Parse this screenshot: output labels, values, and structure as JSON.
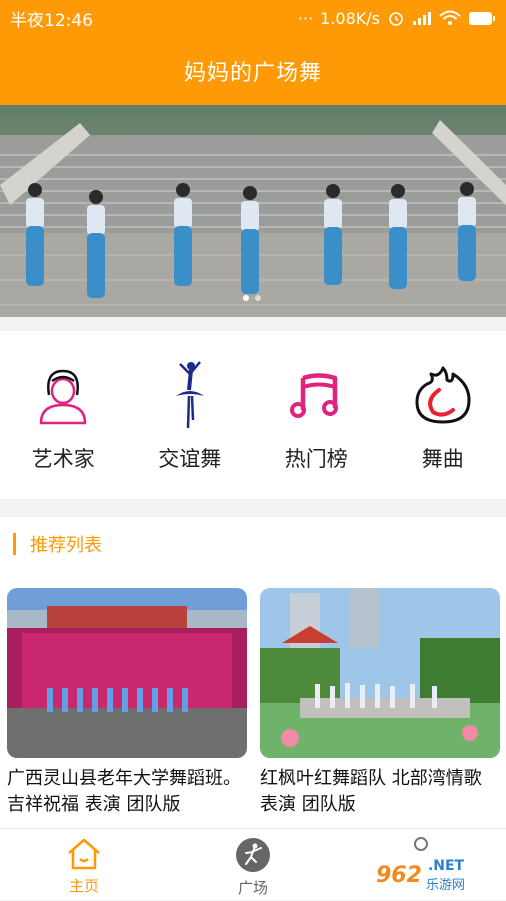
{
  "status_bar": {
    "time": "半夜12:46",
    "speed": "1.08K/s"
  },
  "header": {
    "title": "妈妈的广场舞"
  },
  "categories": [
    {
      "label": "艺术家",
      "icon": "artist-icon"
    },
    {
      "label": "交谊舞",
      "icon": "ballet-dancer-icon"
    },
    {
      "label": "热门榜",
      "icon": "music-note-icon"
    },
    {
      "label": "舞曲",
      "icon": "flame-icon"
    }
  ],
  "recommend": {
    "title": "推荐列表",
    "items": [
      {
        "caption": "广西灵山县老年大学舞蹈班。吉祥祝福 表演 团队版"
      },
      {
        "caption": "红枫叶红舞蹈队 北部湾情歌 表演 团队版"
      }
    ]
  },
  "tabs": [
    {
      "label": "主页",
      "icon": "home-icon",
      "active": true
    },
    {
      "label": "广场",
      "icon": "dancer-icon",
      "active": false
    }
  ],
  "watermark": {
    "brand": "962",
    "net": ".NET",
    "sub": "乐游网"
  },
  "colors": {
    "accent": "#fd9a06",
    "pink": "#e0237e",
    "navy": "#1e2a8a",
    "red": "#e8222e"
  }
}
